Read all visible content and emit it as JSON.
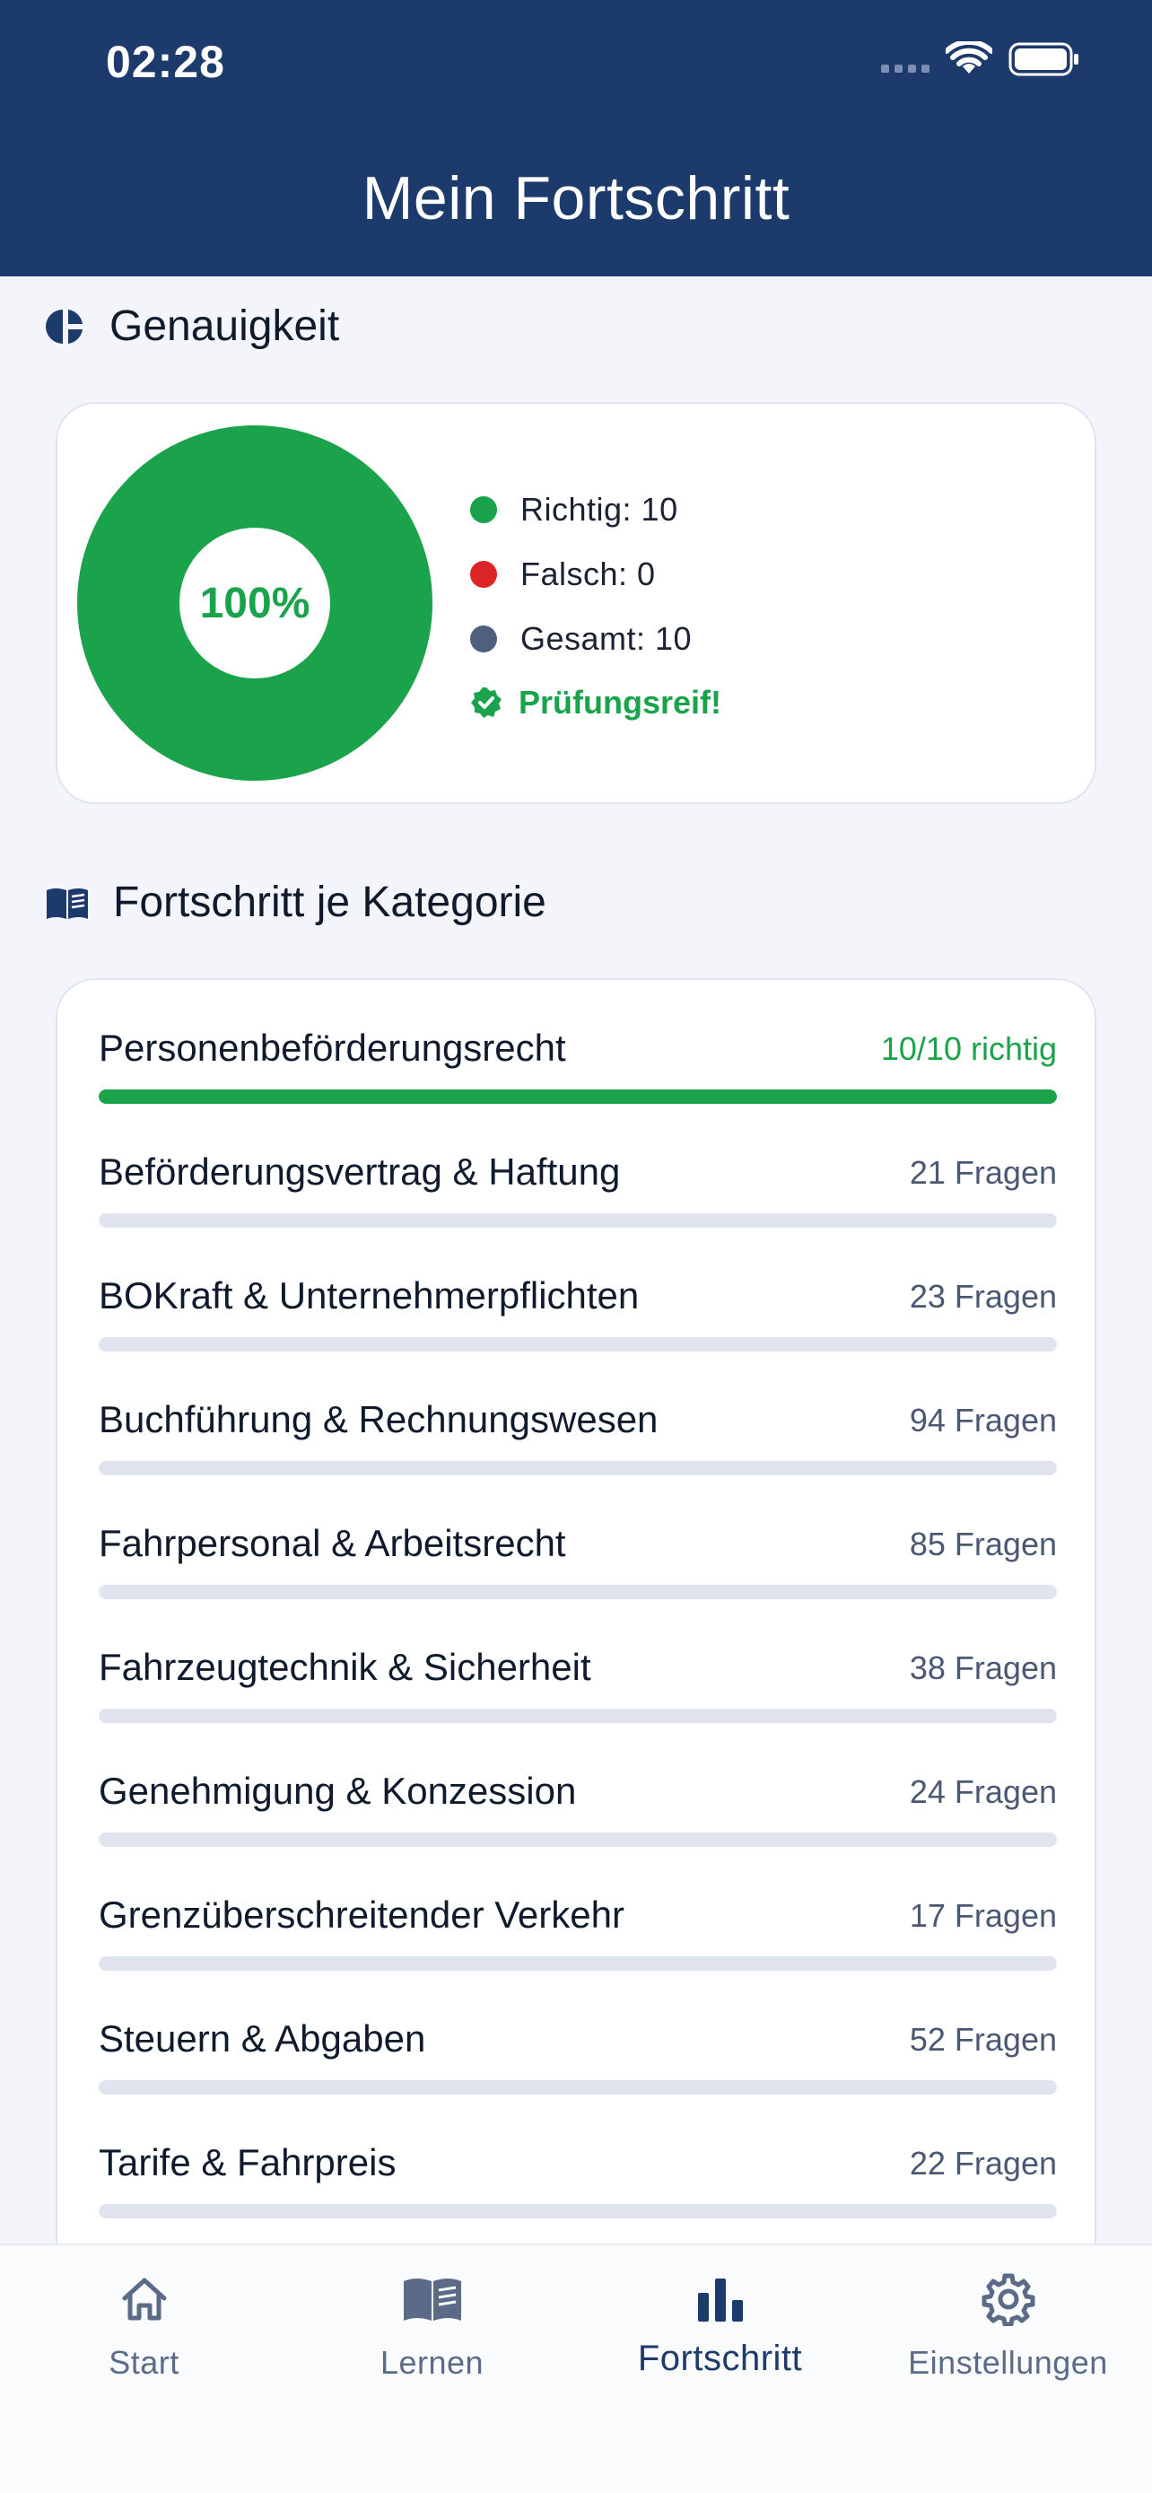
{
  "status_bar": {
    "time": "02:28",
    "icons": [
      "signal-icon",
      "wifi-icon",
      "battery-icon"
    ]
  },
  "header": {
    "title": "Mein Fortschritt"
  },
  "accuracy": {
    "section_title": "Genauigkeit",
    "percent_label": "100%",
    "percent_value": 1.0,
    "legend": [
      {
        "label": "Richtig: 10",
        "color": "#1ba34b"
      },
      {
        "label": "Falsch: 0",
        "color": "#dc2626"
      },
      {
        "label": "Gesamt: 10",
        "color": "#4f5f7e"
      }
    ],
    "status": "Prüfungsreif!"
  },
  "categories": {
    "section_title": "Fortschritt je Kategorie",
    "items": [
      {
        "name": "Personenbeförderungsrecht",
        "meta": "10/10 richtig",
        "progress": 1.0,
        "done": true
      },
      {
        "name": "Beförderungsvertrag & Haftung",
        "meta": "21 Fragen",
        "progress": 0,
        "done": false
      },
      {
        "name": "BOKraft & Unternehmerpflichten",
        "meta": "23 Fragen",
        "progress": 0,
        "done": false
      },
      {
        "name": "Buchführung & Rechnungswesen",
        "meta": "94 Fragen",
        "progress": 0,
        "done": false
      },
      {
        "name": "Fahrpersonal & Arbeitsrecht",
        "meta": "85 Fragen",
        "progress": 0,
        "done": false
      },
      {
        "name": "Fahrzeugtechnik & Sicherheit",
        "meta": "38 Fragen",
        "progress": 0,
        "done": false
      },
      {
        "name": "Genehmigung & Konzession",
        "meta": "24 Fragen",
        "progress": 0,
        "done": false
      },
      {
        "name": "Grenzüberschreitender Verkehr",
        "meta": "17 Fragen",
        "progress": 0,
        "done": false
      },
      {
        "name": "Steuern & Abgaben",
        "meta": "52 Fragen",
        "progress": 0,
        "done": false
      },
      {
        "name": "Tarife & Fahrpreis",
        "meta": "22 Fragen",
        "progress": 0,
        "done": false
      }
    ]
  },
  "tabbar": {
    "tabs": [
      {
        "label": "Start",
        "icon": "home-icon"
      },
      {
        "label": "Lernen",
        "icon": "book-icon"
      },
      {
        "label": "Fortschritt",
        "icon": "bar-chart-icon",
        "active": true
      },
      {
        "label": "Einstellungen",
        "icon": "gear-icon"
      }
    ]
  },
  "colors": {
    "header": "#1c3a6b",
    "accent_green": "#1ba34b",
    "error_red": "#dc2626",
    "neutral": "#4f5f7e"
  }
}
